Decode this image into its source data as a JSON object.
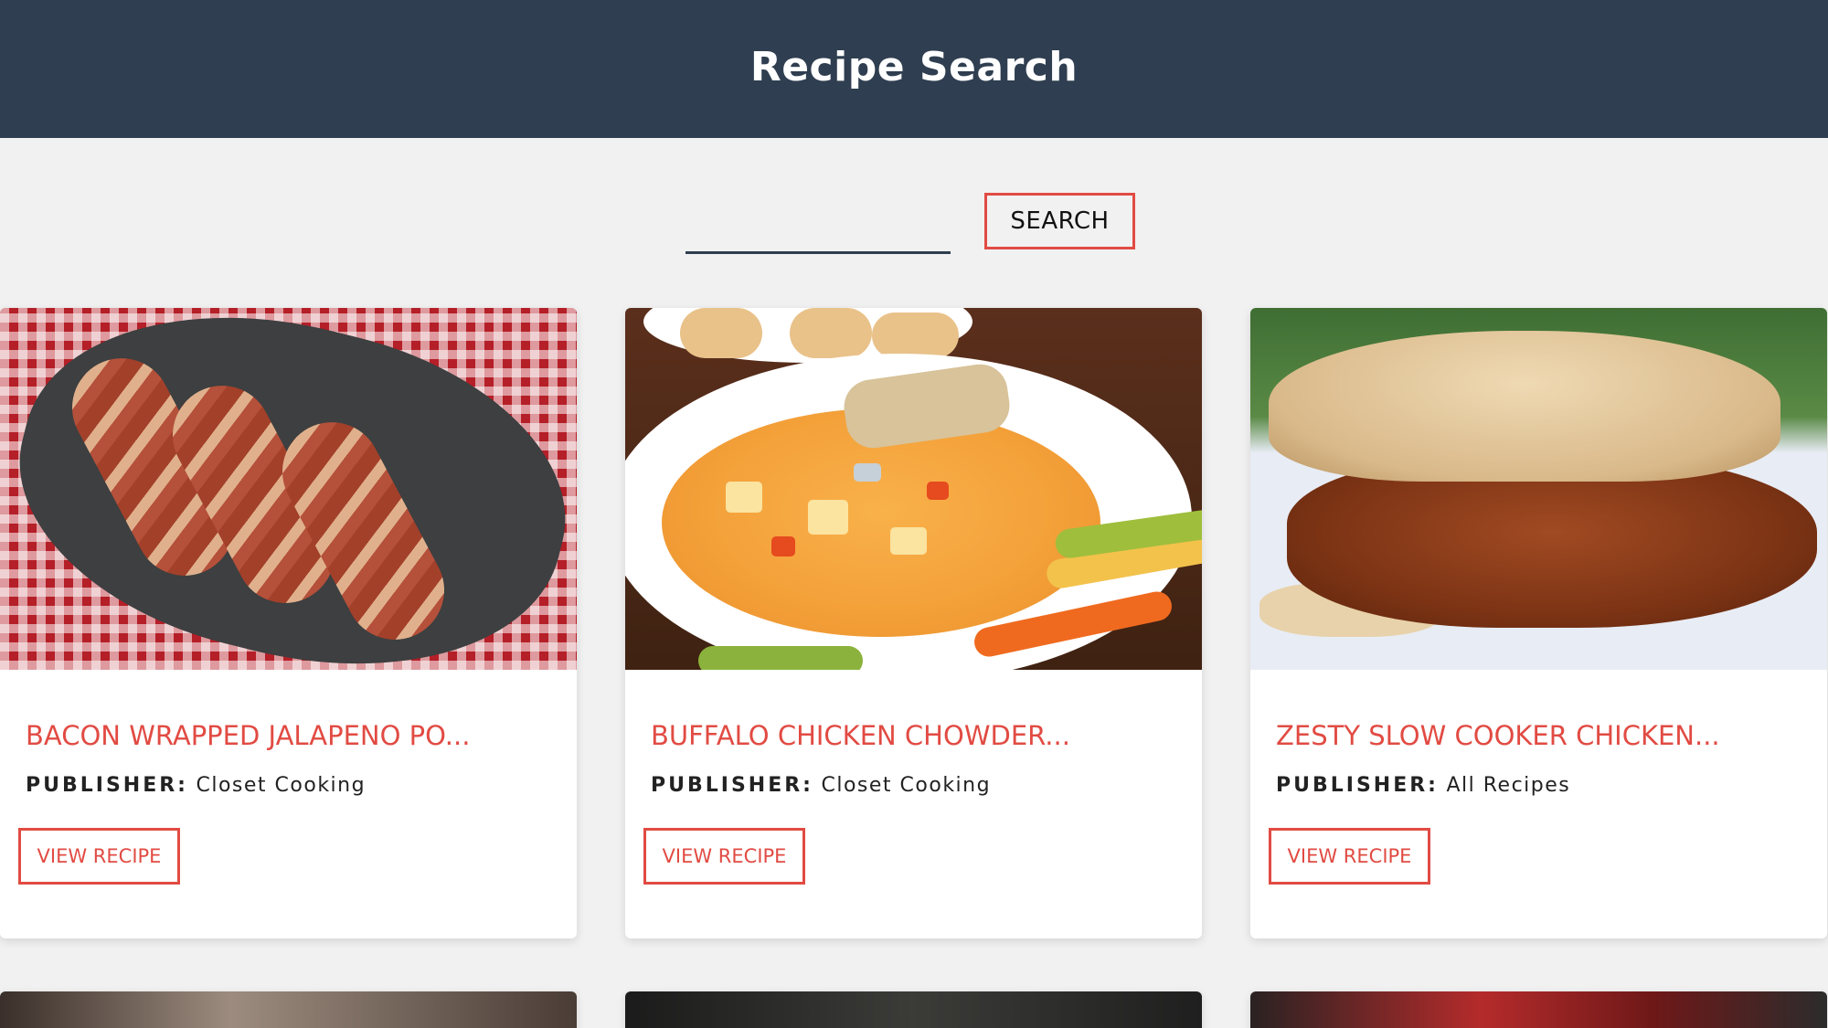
{
  "header": {
    "title": "Recipe Search"
  },
  "search": {
    "value": "",
    "button_label": "SEARCH"
  },
  "recipes": [
    {
      "title": "BACON WRAPPED JALAPENO PO...",
      "publisher_label": "PUBLISHER:",
      "publisher": "Closet Cooking",
      "button_label": "VIEW RECIPE"
    },
    {
      "title": "BUFFALO CHICKEN CHOWDER...",
      "publisher_label": "PUBLISHER:",
      "publisher": "Closet Cooking",
      "button_label": "VIEW RECIPE"
    },
    {
      "title": "ZESTY SLOW COOKER CHICKEN...",
      "publisher_label": "PUBLISHER:",
      "publisher": "All Recipes",
      "button_label": "VIEW RECIPE"
    }
  ],
  "colors": {
    "header_bg": "#2f3e50",
    "accent": "#e14b43",
    "page_bg": "#f1f1f1"
  }
}
